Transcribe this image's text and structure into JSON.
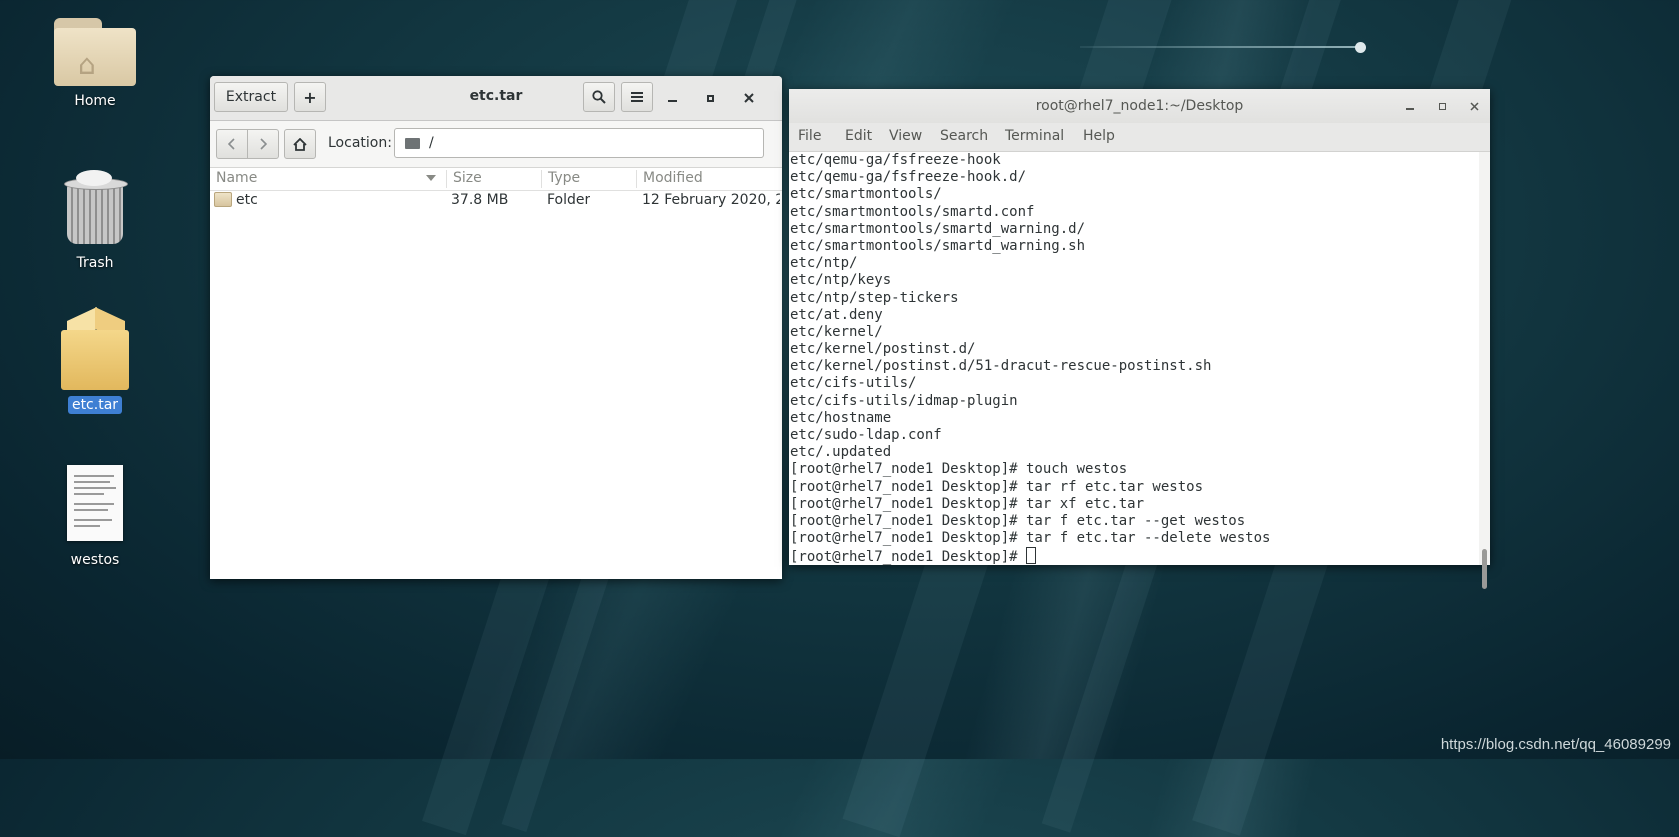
{
  "desktop": {
    "icons": [
      {
        "label": "Home"
      },
      {
        "label": "Trash"
      },
      {
        "label": "etc.tar"
      },
      {
        "label": "westos"
      }
    ],
    "watermark": "https://blog.csdn.net/qq_46089299"
  },
  "file_roller": {
    "title": "etc.tar",
    "extract_label": "Extract",
    "add_label": "+",
    "location_label": "Location:",
    "location_value": "/",
    "columns": [
      "Name",
      "Size",
      "Type",
      "Modified"
    ],
    "rows": [
      {
        "name": "etc",
        "size": "37.8 MB",
        "type": "Folder",
        "modified": "12 February 2020, 2..."
      }
    ]
  },
  "terminal": {
    "title": "root@rhel7_node1:~/Desktop",
    "menu": [
      "File",
      "Edit",
      "View",
      "Search",
      "Terminal",
      "Help"
    ],
    "lines": [
      "etc/qemu-ga/fsfreeze-hook",
      "etc/qemu-ga/fsfreeze-hook.d/",
      "etc/smartmontools/",
      "etc/smartmontools/smartd.conf",
      "etc/smartmontools/smartd_warning.d/",
      "etc/smartmontools/smartd_warning.sh",
      "etc/ntp/",
      "etc/ntp/keys",
      "etc/ntp/step-tickers",
      "etc/at.deny",
      "etc/kernel/",
      "etc/kernel/postinst.d/",
      "etc/kernel/postinst.d/51-dracut-rescue-postinst.sh",
      "etc/cifs-utils/",
      "etc/cifs-utils/idmap-plugin",
      "etc/hostname",
      "etc/sudo-ldap.conf",
      "etc/.updated",
      "[root@rhel7_node1 Desktop]# touch westos",
      "[root@rhel7_node1 Desktop]# tar rf etc.tar westos",
      "[root@rhel7_node1 Desktop]# tar xf etc.tar",
      "[root@rhel7_node1 Desktop]# tar f etc.tar --get westos",
      "[root@rhel7_node1 Desktop]# tar f etc.tar --delete westos"
    ],
    "prompt": "[root@rhel7_node1 Desktop]# "
  }
}
